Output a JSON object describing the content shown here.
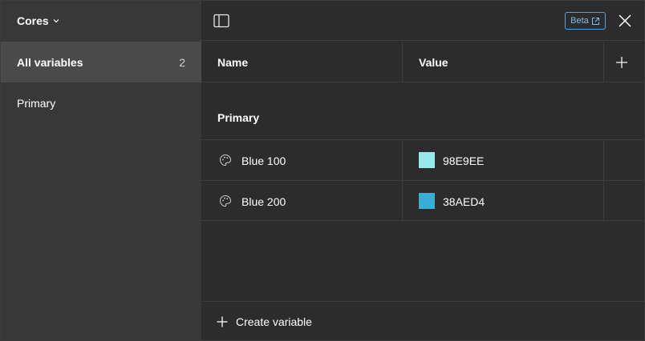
{
  "sidebar": {
    "collection_name": "Cores",
    "items": [
      {
        "label": "All variables",
        "count": "2"
      },
      {
        "label": "Primary"
      }
    ]
  },
  "topbar": {
    "beta_label": "Beta"
  },
  "table": {
    "headers": {
      "name": "Name",
      "value": "Value"
    },
    "group": "Primary",
    "rows": [
      {
        "name": "Blue 100",
        "value": "98E9EE",
        "color": "#98E9EE"
      },
      {
        "name": "Blue 200",
        "value": "38AED4",
        "color": "#38AED4"
      }
    ]
  },
  "footer": {
    "create_label": "Create variable"
  },
  "colors": {
    "accent": "#5ba3dc",
    "sidebar_bg": "#383838",
    "main_bg": "#2c2c2c"
  },
  "icons": [
    "chevron-down-icon",
    "panel-toggle-icon",
    "external-link-icon",
    "close-icon",
    "plus-icon",
    "palette-icon"
  ]
}
